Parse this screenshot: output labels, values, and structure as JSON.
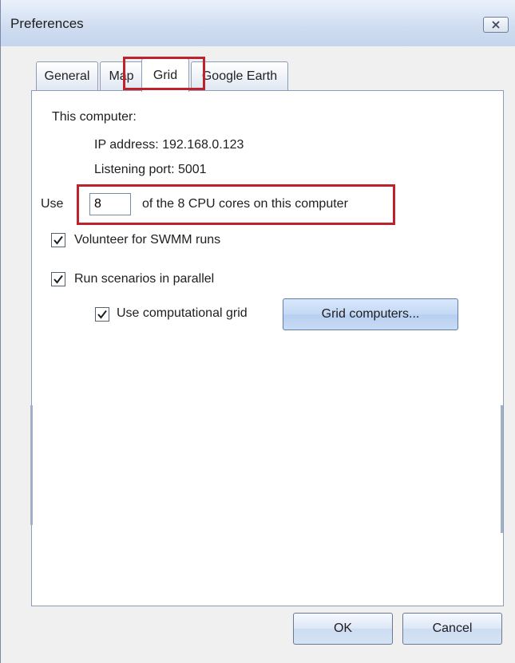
{
  "window": {
    "title": "Preferences",
    "close_icon": "close-icon"
  },
  "tabs": [
    {
      "label": "General",
      "active": false
    },
    {
      "label": "Map",
      "active": false
    },
    {
      "label": "Grid",
      "active": true
    },
    {
      "label": "Google Earth",
      "active": false
    }
  ],
  "grid_tab": {
    "this_computer_label": "This computer:",
    "ip_address": "IP address: 192.168.0.123",
    "listening_port": "Listening port: 5001",
    "use_label": "Use",
    "cores_value": "8",
    "cores_suffix": "of the 8 CPU cores on this computer",
    "volunteer_label": "Volunteer for SWMM runs",
    "volunteer_checked": true,
    "parallel_label": "Run scenarios in parallel",
    "parallel_checked": true,
    "computational_grid_label": "Use computational grid",
    "computational_grid_checked": true,
    "grid_computers_button": "Grid computers..."
  },
  "footer": {
    "ok_label": "OK",
    "cancel_label": "Cancel"
  },
  "colors": {
    "highlight": "#c0222c",
    "titlebar": "#cfdcf0",
    "panel": "#ffffff"
  }
}
